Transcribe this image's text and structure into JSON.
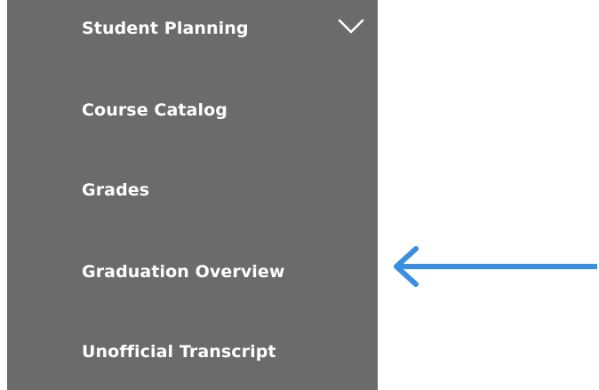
{
  "sidebar": {
    "items": [
      {
        "label": "Student Planning"
      },
      {
        "label": "Course Catalog"
      },
      {
        "label": "Grades"
      },
      {
        "label": "Graduation Overview"
      },
      {
        "label": "Unofficial Transcript"
      }
    ],
    "expand_icon": "chevron-down-icon"
  },
  "annotation": {
    "icon": "arrow-left-icon",
    "color": "#3a8ee0"
  },
  "colors": {
    "sidebar_background": "#6b6b6b",
    "menu_text": "#ffffff"
  }
}
